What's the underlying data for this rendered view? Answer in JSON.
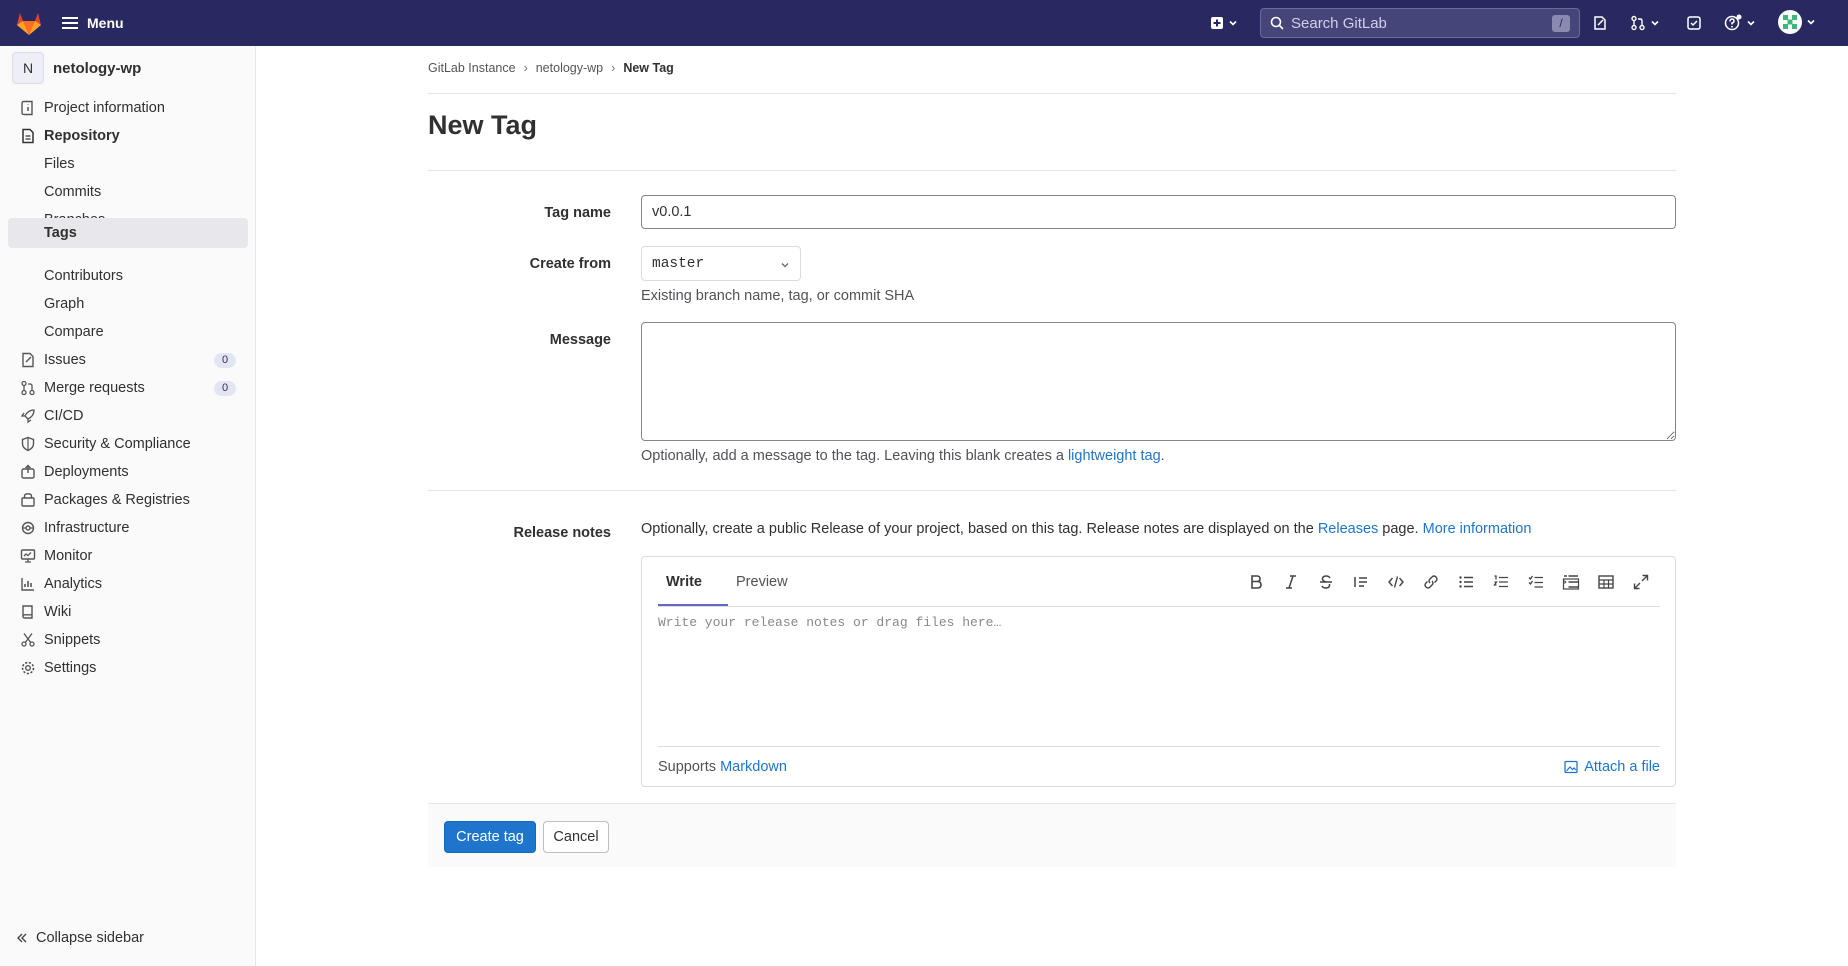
{
  "topbar": {
    "menu_label": "Menu",
    "search_placeholder": "Search GitLab",
    "search_shortcut": "/"
  },
  "sidebar": {
    "project_initial": "N",
    "project_name": "netology-wp",
    "items": [
      {
        "label": "Project information",
        "icon": "info-icon"
      },
      {
        "label": "Repository",
        "icon": "document-icon"
      },
      {
        "label": "Files"
      },
      {
        "label": "Commits"
      },
      {
        "label": "Branches"
      },
      {
        "label": "Tags"
      },
      {
        "label": "Contributors"
      },
      {
        "label": "Graph"
      },
      {
        "label": "Compare"
      },
      {
        "label": "Issues",
        "icon": "issues-icon",
        "badge": "0"
      },
      {
        "label": "Merge requests",
        "icon": "merge-request-icon",
        "badge": "0"
      },
      {
        "label": "CI/CD",
        "icon": "rocket-icon"
      },
      {
        "label": "Security & Compliance",
        "icon": "shield-icon"
      },
      {
        "label": "Deployments",
        "icon": "deployments-icon"
      },
      {
        "label": "Packages & Registries",
        "icon": "package-icon"
      },
      {
        "label": "Infrastructure",
        "icon": "cloud-gear-icon"
      },
      {
        "label": "Monitor",
        "icon": "monitor-icon"
      },
      {
        "label": "Analytics",
        "icon": "chart-icon"
      },
      {
        "label": "Wiki",
        "icon": "book-icon"
      },
      {
        "label": "Snippets",
        "icon": "scissors-icon"
      },
      {
        "label": "Settings",
        "icon": "gear-icon"
      }
    ],
    "collapse_label": "Collapse sidebar"
  },
  "breadcrumb": [
    "GitLab Instance",
    "netology-wp",
    "New Tag"
  ],
  "page_title": "New Tag",
  "form": {
    "tag_name_label": "Tag name",
    "tag_name_value": "v0.0.1",
    "create_from_label": "Create from",
    "create_from_value": "master",
    "create_from_help": "Existing branch name, tag, or commit SHA",
    "message_label": "Message",
    "message_help_prefix": "Optionally, add a message to the tag. Leaving this blank creates a ",
    "message_help_link": "lightweight tag",
    "message_help_suffix": ".",
    "release_label": "Release notes",
    "release_desc_prefix": "Optionally, create a public Release of your project, based on this tag. Release notes are displayed on the ",
    "release_desc_link": "Releases",
    "release_desc_mid": " page. ",
    "release_desc_more": "More information",
    "tab_write": "Write",
    "tab_preview": "Preview",
    "editor_placeholder": "Write your release notes or drag files here…",
    "supports_prefix": "Supports ",
    "supports_link": "Markdown",
    "attach_label": "Attach a file",
    "create_button": "Create tag",
    "cancel_button": "Cancel"
  },
  "colors": {
    "topbar": "#292961",
    "primary": "#1f75cb",
    "tab_accent": "#6666c4"
  }
}
